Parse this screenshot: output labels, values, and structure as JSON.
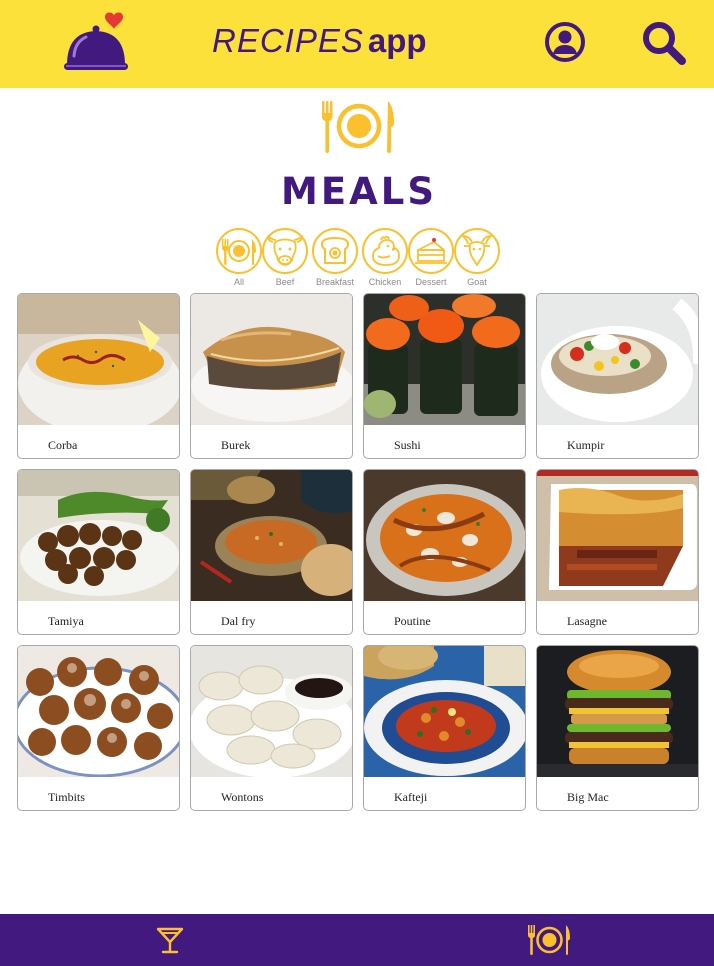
{
  "header": {
    "title_part1": "RECIPES",
    "title_part2": "app",
    "background": "#fde13b",
    "accent": "#41197f",
    "icons": {
      "logo": "cloche-heart-icon",
      "profile": "profile-icon",
      "search": "search-icon"
    }
  },
  "page": {
    "title": "MEALS",
    "icon": "plate-cutlery-icon"
  },
  "filters": [
    {
      "label": "All",
      "icon": "plate-icon"
    },
    {
      "label": "Beef",
      "icon": "cow-icon"
    },
    {
      "label": "Breakfast",
      "icon": "toast-icon"
    },
    {
      "label": "Chicken",
      "icon": "chicken-icon"
    },
    {
      "label": "Dessert",
      "icon": "cake-icon"
    },
    {
      "label": "Goat",
      "icon": "goat-icon"
    }
  ],
  "recipes": [
    {
      "name": "Corba"
    },
    {
      "name": "Burek"
    },
    {
      "name": "Sushi"
    },
    {
      "name": "Kumpir"
    },
    {
      "name": "Tamiya"
    },
    {
      "name": "Dal fry"
    },
    {
      "name": "Poutine"
    },
    {
      "name": "Lasagne"
    },
    {
      "name": "Timbits"
    },
    {
      "name": "Wontons"
    },
    {
      "name": "Kafteji"
    },
    {
      "name": "Big Mac"
    }
  ],
  "bottom_nav": {
    "background": "#41197f",
    "icons": {
      "drinks": "cocktail-icon",
      "meals": "plate-cutlery-icon"
    }
  }
}
